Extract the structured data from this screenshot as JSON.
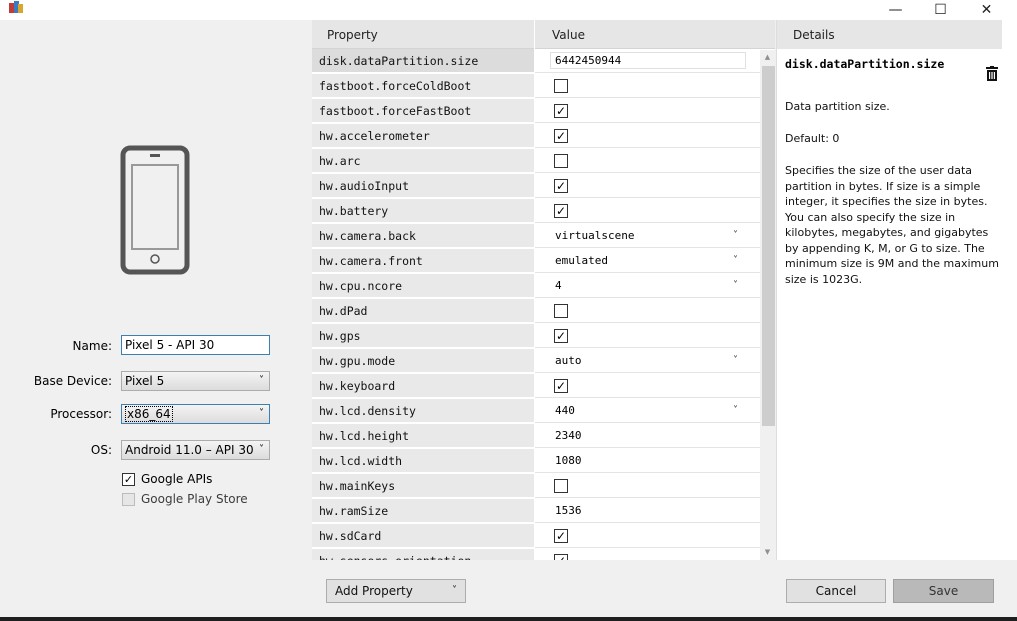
{
  "window": {
    "minimize_glyph": "—",
    "maximize_glyph": "☐",
    "close_glyph": "✕"
  },
  "form": {
    "name_label": "Name:",
    "name_value": "Pixel 5 - API 30",
    "base_device_label": "Base Device:",
    "base_device_value": "Pixel 5",
    "processor_label": "Processor:",
    "processor_value": "x86_64",
    "os_label": "OS:",
    "os_value": "Android 11.0 – API 30",
    "google_apis_label": "Google APIs",
    "google_apis_checked": true,
    "google_play_label": "Google Play Store",
    "google_play_checked": false
  },
  "grid": {
    "property_header": "Property",
    "value_header": "Value",
    "rows": [
      {
        "property": "disk.dataPartition.size",
        "type": "text",
        "value": "6442450944",
        "selected": true
      },
      {
        "property": "fastboot.forceColdBoot",
        "type": "check",
        "checked": false
      },
      {
        "property": "fastboot.forceFastBoot",
        "type": "check",
        "checked": true
      },
      {
        "property": "hw.accelerometer",
        "type": "check",
        "checked": true
      },
      {
        "property": "hw.arc",
        "type": "check",
        "checked": false
      },
      {
        "property": "hw.audioInput",
        "type": "check",
        "checked": true
      },
      {
        "property": "hw.battery",
        "type": "check",
        "checked": true
      },
      {
        "property": "hw.camera.back",
        "type": "select",
        "value": "virtualscene"
      },
      {
        "property": "hw.camera.front",
        "type": "select",
        "value": "emulated"
      },
      {
        "property": "hw.cpu.ncore",
        "type": "select",
        "value": "4"
      },
      {
        "property": "hw.dPad",
        "type": "check",
        "checked": false
      },
      {
        "property": "hw.gps",
        "type": "check",
        "checked": true
      },
      {
        "property": "hw.gpu.mode",
        "type": "select",
        "value": "auto"
      },
      {
        "property": "hw.keyboard",
        "type": "check",
        "checked": true
      },
      {
        "property": "hw.lcd.density",
        "type": "select",
        "value": "440"
      },
      {
        "property": "hw.lcd.height",
        "type": "plain",
        "value": "2340"
      },
      {
        "property": "hw.lcd.width",
        "type": "plain",
        "value": "1080"
      },
      {
        "property": "hw.mainKeys",
        "type": "check",
        "checked": false
      },
      {
        "property": "hw.ramSize",
        "type": "plain",
        "value": "1536"
      },
      {
        "property": "hw.sdCard",
        "type": "check",
        "checked": true
      },
      {
        "property": "hw.sensors.orientation",
        "type": "check",
        "checked": true
      }
    ]
  },
  "details": {
    "header": "Details",
    "title": "disk.dataPartition.size",
    "summary": "Data partition size.",
    "default": "Default: 0",
    "description": "Specifies the size of the user data partition in bytes. If size is a simple integer, it specifies the size in bytes. You can also specify the size in kilobytes, megabytes, and gigabytes by appending K, M, or G to size. The minimum size is 9M and the maximum size is 1023G."
  },
  "buttons": {
    "add_property": "Add Property",
    "cancel": "Cancel",
    "save": "Save"
  },
  "icons": {
    "check_glyph": "✓",
    "caret_glyph": "˅",
    "scroll_up_glyph": "▲",
    "scroll_down_glyph": "▼"
  },
  "colors": {
    "focus_border": "#3c7fb1",
    "header_bg": "#e6e6e6",
    "property_cell_bg": "#e9e9e9"
  }
}
